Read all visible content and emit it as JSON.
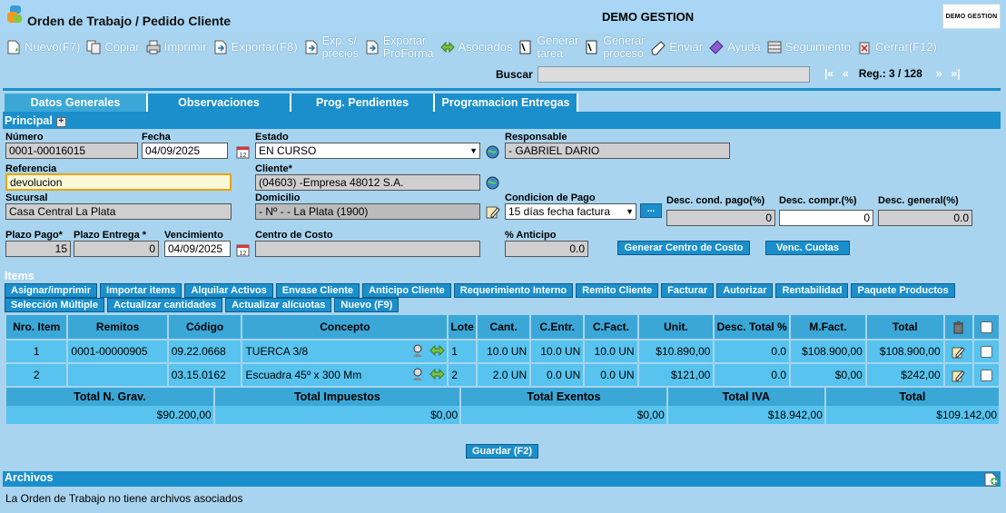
{
  "header": {
    "title": "Orden de Trabajo / Pedido Cliente",
    "company": "DEMO GESTION",
    "company_logo_text": "DEMO GESTION"
  },
  "toolbar": [
    {
      "id": "nuevo",
      "label": "Nuevo(F7)",
      "icon": "new-document-icon"
    },
    {
      "id": "copiar",
      "label": "Copiar",
      "icon": "copy-icon"
    },
    {
      "id": "imprimir",
      "label": "Imprimir",
      "icon": "printer-icon"
    },
    {
      "id": "exportar",
      "label": "Exportar(F8)",
      "icon": "export-icon"
    },
    {
      "id": "exp-precios",
      "label1": "Exp. s/",
      "label2": "precios",
      "icon": "export-icon"
    },
    {
      "id": "exportar-proforma",
      "label1": "Exportar",
      "label2": "ProForma",
      "icon": "export-icon"
    },
    {
      "id": "asociados",
      "label": "Asociados",
      "icon": "arrows-icon"
    },
    {
      "id": "generar-tarea",
      "label1": "Generar",
      "label2": "tarea",
      "icon": "task-icon"
    },
    {
      "id": "generar-proceso",
      "label1": "Generar",
      "label2": "proceso",
      "icon": "process-icon"
    },
    {
      "id": "enviar",
      "label": "Enviar",
      "icon": "send-icon"
    },
    {
      "id": "ayuda",
      "label": "Ayuda",
      "icon": "help-icon"
    },
    {
      "id": "seguimiento",
      "label": "Seguimiento",
      "icon": "tracking-icon"
    },
    {
      "id": "cerrar",
      "label": "Cerrar(F12)",
      "icon": "close-icon"
    }
  ],
  "search": {
    "label": "Buscar",
    "value": ""
  },
  "pager": {
    "first": "|«",
    "prev": "«",
    "record": "Reg.: 3 / 128",
    "next": "»",
    "last": "»|"
  },
  "tabs": [
    "Datos Generales",
    "Observaciones",
    "Prog. Pendientes",
    "Programacion Entregas"
  ],
  "principal": {
    "title": "Principal",
    "numero": {
      "label": "Número",
      "value": "0001-00016015"
    },
    "fecha": {
      "label": "Fecha",
      "value": "04/09/2025"
    },
    "estado": {
      "label": "Estado",
      "value": "EN CURSO"
    },
    "responsable": {
      "label": "Responsable",
      "value": "- GABRIEL DARIO"
    },
    "referencia": {
      "label": "Referencia",
      "value": "devolucion"
    },
    "cliente": {
      "label": "Cliente*",
      "value": "(04603) -Empresa 48012 S.A."
    },
    "sucursal": {
      "label": "Sucursal",
      "value": "Casa Central La Plata"
    },
    "domicilio": {
      "label": "Domicilio",
      "value": "- Nº - - La Plata (1900)"
    },
    "condicion_pago": {
      "label": "Condicion de Pago",
      "value": "15 días fecha factura",
      "dots": "..."
    },
    "desc_cond_pago": {
      "label": "Desc. cond. pago(%)",
      "value": "0"
    },
    "desc_compr": {
      "label": "Desc. compr.(%)",
      "value": "0"
    },
    "desc_general": {
      "label": "Desc. general(%)",
      "value": "0.0"
    },
    "plazo_pago": {
      "label": "Plazo Pago*",
      "value": "15"
    },
    "plazo_entrega": {
      "label": "Plazo Entrega *",
      "value": "0"
    },
    "vencimiento": {
      "label": "Vencimiento",
      "value": "04/09/2025"
    },
    "centro_costo": {
      "label": "Centro de Costo",
      "value": ""
    },
    "anticipo": {
      "label": "% Anticipo",
      "value": "0.0"
    },
    "btn_generar_cc": "Generar Centro de Costo",
    "btn_venc_cuotas": "Venc. Cuotas"
  },
  "items": {
    "title": "Items",
    "buttons_row1": [
      "Asignar/imprimir",
      "Importar items",
      "Alquilar Activos",
      "Envase Cliente",
      "Anticipo Cliente",
      "Requerimiento Interno",
      "Remito Cliente",
      "Facturar",
      "Autorizar",
      "Rentabilidad",
      "Paquete Productos"
    ],
    "buttons_row2": [
      "Selección Múltiple",
      "Actualizar cantidades",
      "Actualizar alícuotas",
      "Nuevo (F9)"
    ],
    "columns": [
      "Nro. Item",
      "Remitos",
      "Código",
      "Concepto",
      "Lote",
      "Cant.",
      "C.Entr.",
      "C.Fact.",
      "Unit.",
      "Desc. Total %",
      "M.Fact.",
      "Total"
    ],
    "rows": [
      {
        "nro": "1",
        "remito": "0001-00000905",
        "codigo": "09.22.0668",
        "concepto": "TUERCA 3/8",
        "lote": "1",
        "cant": "10.0 UN",
        "centr": "10.0 UN",
        "cfact": "10.0 UN",
        "unit": "$10.890,00",
        "desc": "0.0",
        "mfact": "$108.900,00",
        "total": "$108.900,00"
      },
      {
        "nro": "2",
        "remito": "",
        "codigo": "03.15.0162",
        "concepto": "Escuadra 45º x 300 Mm",
        "lote": "2",
        "cant": "2.0 UN",
        "centr": "0.0 UN",
        "cfact": "0.0 UN",
        "unit": "$121,00",
        "desc": "0.0",
        "mfact": "$0,00",
        "total": "$242,00"
      }
    ]
  },
  "totals": {
    "headers": [
      "Total N. Grav.",
      "Total Impuestos",
      "Total Exentos",
      "Total IVA",
      "Total"
    ],
    "values": [
      "$90.200,00",
      "$0,00",
      "$0,00",
      "$18.942,00",
      "$109.142,00"
    ]
  },
  "save_label": "Guardar (F2)",
  "archivos": {
    "title": "Archivos",
    "empty_text": "La Orden de Trabajo no tiene archivos asociados"
  }
}
